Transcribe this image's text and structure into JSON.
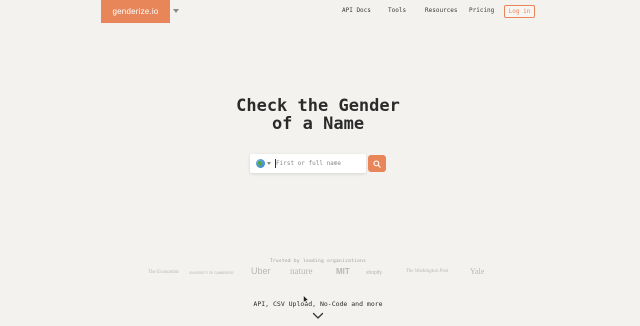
{
  "header": {
    "logo": "genderize.io",
    "nav": [
      "API Docs",
      "Tools",
      "Resources",
      "Pricing"
    ],
    "login": "Log in"
  },
  "hero": {
    "title_line1": "Check the Gender",
    "title_line2": "of a Name",
    "search_placeholder": "First or full name",
    "search_value": ""
  },
  "trusted": {
    "label": "Trusted by leading organizations",
    "brands": [
      "The Economist",
      "UNIVERSITY OF CAMBRIDGE",
      "Uber",
      "nature",
      "MIT",
      "shopify",
      "The Washington Post",
      "Yale"
    ]
  },
  "bottom": {
    "label": "API, CSV Upload, No-Code and more"
  },
  "colors": {
    "accent": "#e8865a",
    "background": "#f3f2ee"
  },
  "icons": [
    "globe-icon",
    "search-icon",
    "chevron-down-icon"
  ]
}
